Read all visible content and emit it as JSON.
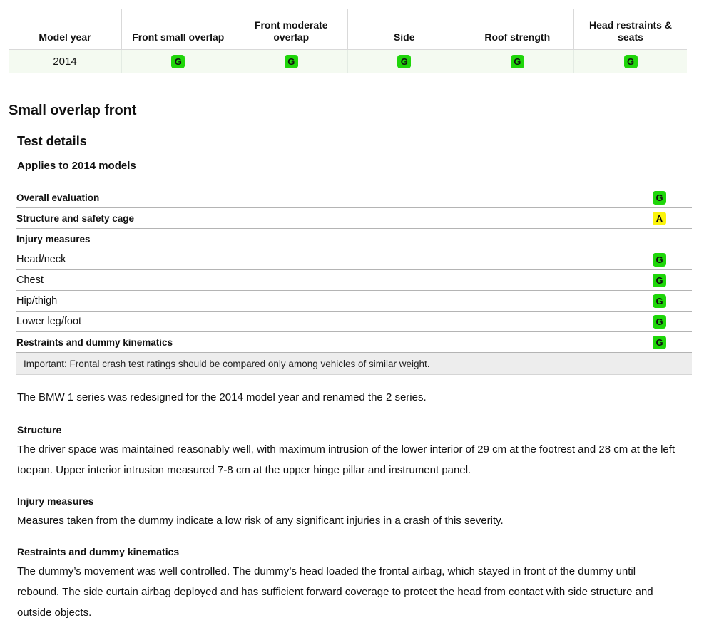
{
  "ratings_table": {
    "columns": [
      "Model year",
      "Front small overlap",
      "Front moderate overlap",
      "Side",
      "Roof strength",
      "Head restraints & seats"
    ],
    "rows": [
      {
        "model_year": "2014",
        "ratings": [
          {
            "code": "G",
            "class": "g"
          },
          {
            "code": "G",
            "class": "g"
          },
          {
            "code": "G",
            "class": "g"
          },
          {
            "code": "G",
            "class": "g"
          },
          {
            "code": "G",
            "class": "g"
          }
        ]
      }
    ]
  },
  "headings": {
    "section_title": "Small overlap front",
    "subsection_title": "Test details",
    "applies_to": "Applies to 2014 models"
  },
  "detail_table": {
    "rows": [
      {
        "label": "Overall evaluation",
        "level": 0,
        "code": "G",
        "class": "g"
      },
      {
        "label": "Structure and safety cage",
        "level": 0,
        "code": "A",
        "class": "a"
      },
      {
        "label": "Injury measures",
        "level": 0,
        "code": "",
        "class": "none"
      },
      {
        "label": "Head/neck",
        "level": 1,
        "code": "G",
        "class": "g"
      },
      {
        "label": "Chest",
        "level": 1,
        "code": "G",
        "class": "g"
      },
      {
        "label": "Hip/thigh",
        "level": 1,
        "code": "G",
        "class": "g"
      },
      {
        "label": "Lower leg/foot",
        "level": 1,
        "code": "G",
        "class": "g"
      },
      {
        "label": "Restraints and dummy kinematics",
        "level": 0,
        "code": "G",
        "class": "g"
      }
    ],
    "note": "Important: Frontal crash test ratings should be compared only among vehicles of similar weight."
  },
  "body": {
    "lead": "The BMW 1 series was redesigned for the 2014 model year and renamed the 2 series.",
    "blocks": [
      {
        "heading": "Structure",
        "text": "The driver space was maintained reasonably well, with maximum intrusion of the lower interior of 29 cm at the footrest and 28 cm at the left toepan. Upper interior intrusion measured 7-8 cm at the upper hinge pillar and instrument panel."
      },
      {
        "heading": "Injury measures",
        "text": "Measures taken from the dummy indicate a low risk of any significant injuries in a crash of this severity."
      },
      {
        "heading": "Restraints and dummy kinematics",
        "text": "The dummy’s movement was well controlled. The dummy’s head loaded the frontal airbag, which stayed in front of the dummy until rebound. The side curtain airbag deployed and has sufficient forward coverage to protect the head from contact with side structure and outside objects."
      }
    ]
  },
  "colors": {
    "good": "#1fd60a",
    "acceptable": "#fbf40c",
    "marginal": "#f6a21d",
    "poor": "#ee2d24",
    "row_tint": "#f4faf1",
    "note_band": "#ededed"
  }
}
